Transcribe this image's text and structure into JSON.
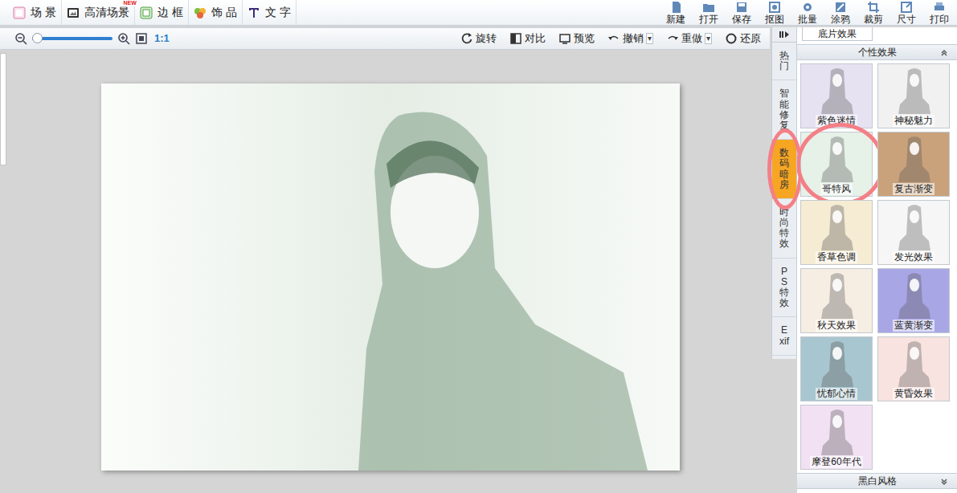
{
  "toolbar": {
    "left": [
      {
        "label": "场 景",
        "badge": null
      },
      {
        "label": "高清场景",
        "badge": "NEW"
      },
      {
        "label": "边 框",
        "badge": null
      },
      {
        "label": "饰 品",
        "badge": null
      },
      {
        "label": "文 字",
        "badge": null
      }
    ],
    "right": [
      "新建",
      "打开",
      "保存",
      "抠图",
      "批量",
      "涂鸦",
      "裁剪",
      "尺寸",
      "打印"
    ]
  },
  "zoom": {
    "level": 0.06,
    "ratio": "1:1"
  },
  "actions": [
    {
      "label": "旋转",
      "arrow": null
    },
    {
      "label": "对比",
      "arrow": null
    },
    {
      "label": "预览",
      "arrow": null
    },
    {
      "label": "撤销",
      "arrow": "▾"
    },
    {
      "label": "重做",
      "arrow": "▾"
    },
    {
      "label": "还原",
      "arrow": null
    }
  ],
  "side_tabs": [
    {
      "label": "热门",
      "selected": false,
      "circled": false
    },
    {
      "label": "智能修复",
      "selected": false,
      "circled": false
    },
    {
      "label": "数码暗房",
      "selected": true,
      "circled": true
    },
    {
      "label": "时尚特效",
      "selected": false,
      "circled": false
    },
    {
      "label": "PS特效",
      "selected": false,
      "circled": false
    },
    {
      "label": "Exif",
      "selected": false,
      "circled": false
    }
  ],
  "panel": {
    "top_item": "底片效果",
    "sections": [
      {
        "title": "个性效果",
        "expanded": true,
        "effects": [
          {
            "label": "紫色迷情",
            "color": "#e6e2f2",
            "circled": false
          },
          {
            "label": "神秘魅力",
            "color": "#f1f1f1",
            "circled": false
          },
          {
            "label": "哥特风",
            "color": "#e6f1e8",
            "circled": true
          },
          {
            "label": "复古渐变",
            "color": "#c9a27c",
            "circled": false
          },
          {
            "label": "香草色调",
            "color": "#f6ecd4",
            "circled": false
          },
          {
            "label": "发光效果",
            "color": "#f6f6f6",
            "circled": false
          },
          {
            "label": "秋天效果",
            "color": "#f6ede3",
            "circled": false
          },
          {
            "label": "蓝黄渐变",
            "color": "#a9a6e6",
            "circled": false
          },
          {
            "label": "忧郁心情",
            "color": "#a8c6d0",
            "circled": false
          },
          {
            "label": "黄昏效果",
            "color": "#f8e3e0",
            "circled": false
          },
          {
            "label": "摩登60年代",
            "color": "#f1e1f3",
            "circled": false
          }
        ]
      },
      {
        "title": "黑白风格",
        "expanded": false,
        "effects": []
      }
    ]
  }
}
